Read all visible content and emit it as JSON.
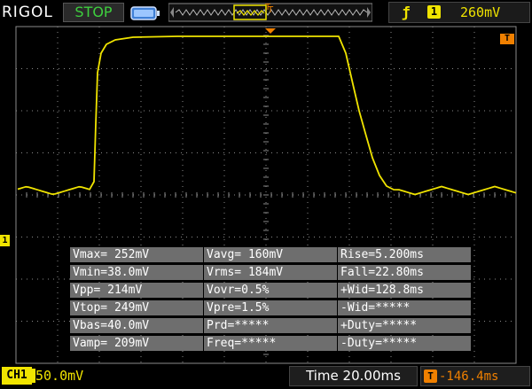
{
  "header": {
    "brand": "RIGOL",
    "run_state": "STOP",
    "trigger": {
      "source": "1",
      "level": "260mV",
      "edge_icon": "rising-edge-icon"
    }
  },
  "markers": {
    "trigger_level": "T",
    "trigger_position": "T",
    "ch1_ground": "1"
  },
  "measurements": [
    [
      "Vmax= 252mV",
      "Vavg= 160mV",
      "Rise=5.200ms"
    ],
    [
      "Vmin=38.0mV",
      "Vrms= 184mV",
      "Fall=22.80ms"
    ],
    [
      "Vpp= 214mV",
      "Vovr=0.5%",
      "+Wid=128.8ms"
    ],
    [
      "Vtop= 249mV",
      "Vpre=1.5%",
      "-Wid=*****"
    ],
    [
      "Vbas=40.0mV",
      "Prd=*****",
      "+Duty=*****"
    ],
    [
      "Vamp= 209mV",
      "Freq=*****",
      "-Duty=*****"
    ]
  ],
  "footer": {
    "ch1_label": "CH1",
    "ch1_scale": "50.0mV",
    "timebase": "Time 20.00ms",
    "hpos_icon": "T",
    "hpos_value": "-146.4ms"
  },
  "colors": {
    "trace": "#f0e400",
    "trigger": "#f08000",
    "run_state": "#3ecf3e",
    "grid": "#8a8a8a",
    "measure_bg": "#6e6e6e"
  },
  "trace_data": {
    "baseline_mV": 40,
    "high_mV": 252,
    "rise_ms": 5.2,
    "fall_ms": 22.8,
    "positive_width_ms": 128.8
  }
}
